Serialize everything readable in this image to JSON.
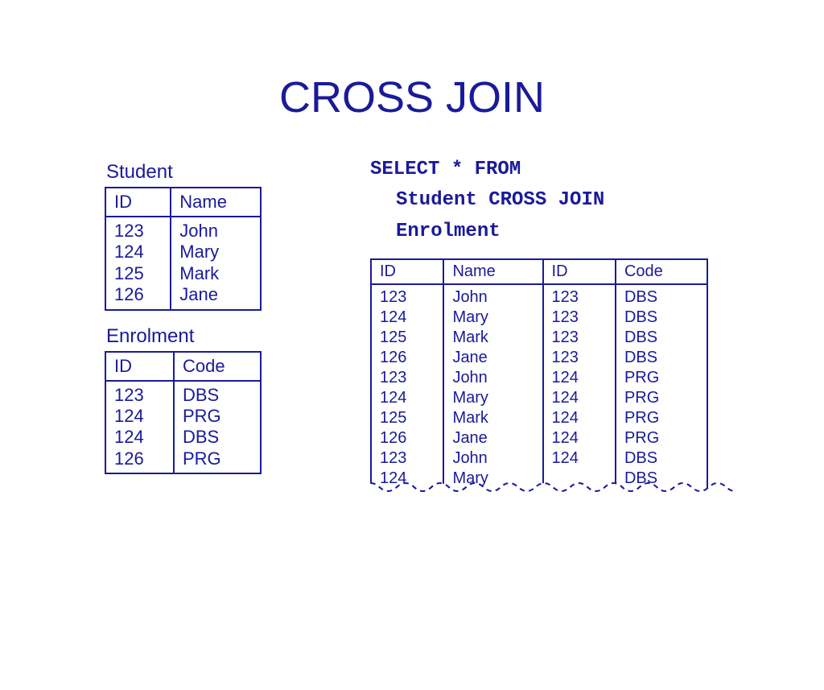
{
  "title": "CROSS JOIN",
  "student": {
    "label": "Student",
    "headers": [
      "ID",
      "Name"
    ],
    "rows": [
      [
        "123",
        "John"
      ],
      [
        "124",
        "Mary"
      ],
      [
        "125",
        "Mark"
      ],
      [
        "126",
        "Jane"
      ]
    ]
  },
  "enrolment": {
    "label": "Enrolment",
    "headers": [
      "ID",
      "Code"
    ],
    "rows": [
      [
        "123",
        "DBS"
      ],
      [
        "124",
        "PRG"
      ],
      [
        "124",
        "DBS"
      ],
      [
        "126",
        "PRG"
      ]
    ]
  },
  "sql": {
    "line1": "SELECT * FROM",
    "line2": "Student CROSS JOIN",
    "line3": "Enrolment"
  },
  "result": {
    "headers": [
      "ID",
      "Name",
      "ID",
      "Code"
    ],
    "rows": [
      [
        "123",
        "John",
        "123",
        "DBS"
      ],
      [
        "124",
        "Mary",
        "123",
        "DBS"
      ],
      [
        "125",
        "Mark",
        "123",
        "DBS"
      ],
      [
        "126",
        "Jane",
        "123",
        "DBS"
      ],
      [
        "123",
        "John",
        "124",
        "PRG"
      ],
      [
        "124",
        "Mary",
        "124",
        "PRG"
      ],
      [
        "125",
        "Mark",
        "124",
        "PRG"
      ],
      [
        "126",
        "Jane",
        "124",
        "PRG"
      ],
      [
        "123",
        "John",
        "124",
        "DBS"
      ],
      [
        "124",
        "Mary",
        "",
        "DBS"
      ]
    ]
  },
  "chart_data": {
    "type": "table",
    "title": "CROSS JOIN",
    "tables": {
      "Student": {
        "columns": [
          "ID",
          "Name"
        ],
        "rows": [
          [
            "123",
            "John"
          ],
          [
            "124",
            "Mary"
          ],
          [
            "125",
            "Mark"
          ],
          [
            "126",
            "Jane"
          ]
        ]
      },
      "Enrolment": {
        "columns": [
          "ID",
          "Code"
        ],
        "rows": [
          [
            "123",
            "DBS"
          ],
          [
            "124",
            "PRG"
          ],
          [
            "124",
            "DBS"
          ],
          [
            "126",
            "PRG"
          ]
        ]
      },
      "Result": {
        "columns": [
          "ID",
          "Name",
          "ID",
          "Code"
        ],
        "rows": [
          [
            "123",
            "John",
            "123",
            "DBS"
          ],
          [
            "124",
            "Mary",
            "123",
            "DBS"
          ],
          [
            "125",
            "Mark",
            "123",
            "DBS"
          ],
          [
            "126",
            "Jane",
            "123",
            "DBS"
          ],
          [
            "123",
            "John",
            "124",
            "PRG"
          ],
          [
            "124",
            "Mary",
            "124",
            "PRG"
          ],
          [
            "125",
            "Mark",
            "124",
            "PRG"
          ],
          [
            "126",
            "Jane",
            "124",
            "PRG"
          ],
          [
            "123",
            "John",
            "124",
            "DBS"
          ],
          [
            "124",
            "Mary",
            "",
            "DBS"
          ]
        ],
        "truncated": true
      }
    },
    "sql": "SELECT * FROM Student CROSS JOIN Enrolment"
  }
}
